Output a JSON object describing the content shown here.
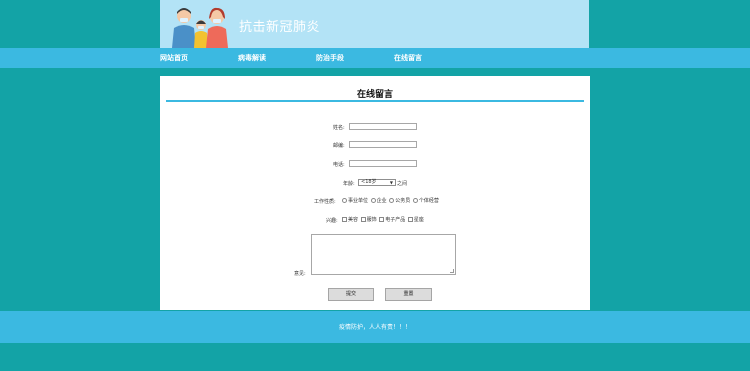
{
  "header": {
    "title": "抗击新冠肺炎",
    "illustration": "family-with-masks"
  },
  "nav": {
    "items": [
      {
        "label": "网站首页"
      },
      {
        "label": "病毒解读"
      },
      {
        "label": "防治手段"
      },
      {
        "label": "在线留言"
      }
    ]
  },
  "form": {
    "title": "在线留言",
    "name_label": "姓名:",
    "name_value": "",
    "email_label": "邮编:",
    "email_value": "",
    "phone_label": "电话:",
    "phone_value": "",
    "age_label": "年龄:",
    "age_selected": "<18岁",
    "age_suffix": "之间",
    "job_label": "工作性质:",
    "job_options": [
      "事业单位",
      "企业",
      "公务员",
      "个体经营"
    ],
    "interest_label": "兴趣:",
    "interest_options": [
      "美容",
      "服饰",
      "电子产品",
      "星座"
    ],
    "advice_label": "意见:",
    "advice_value": "",
    "submit_label": "提交",
    "reset_label": "重置"
  },
  "footer": {
    "text": "疫情防护，人人有责！！！"
  },
  "colors": {
    "background": "#13a3a6",
    "accent": "#3bb9e1",
    "banner": "#b3e3f6"
  }
}
